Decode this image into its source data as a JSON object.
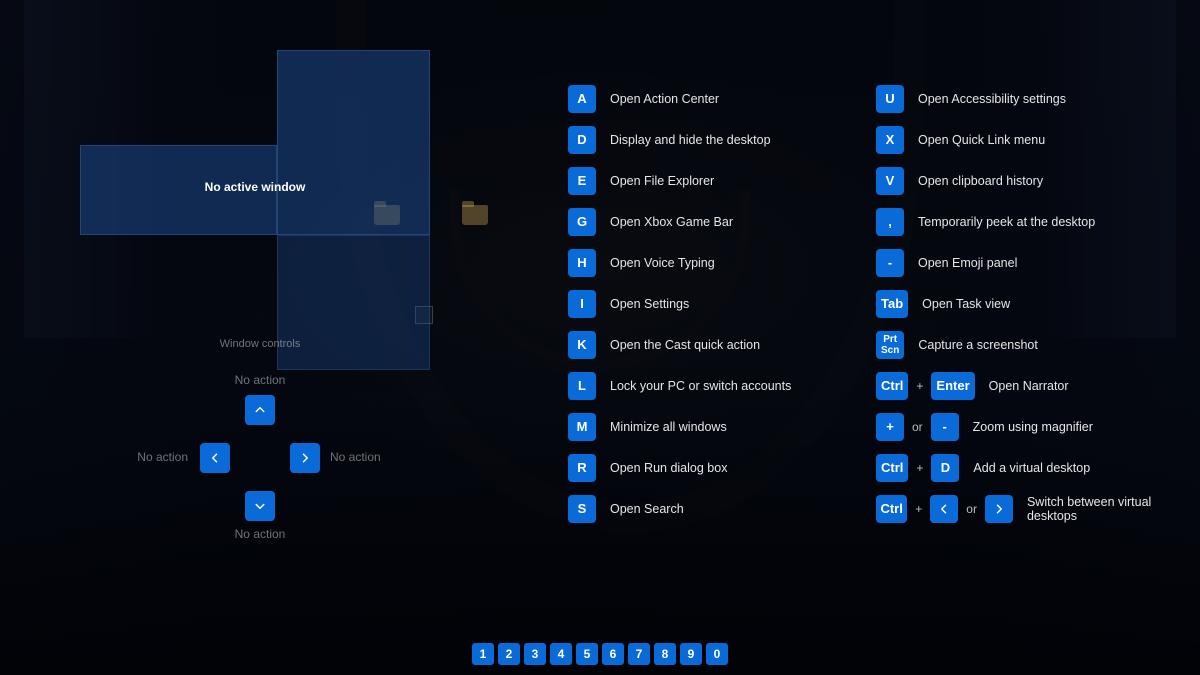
{
  "panel": {
    "no_active": "No active window",
    "section_label": "Window controls"
  },
  "dpad": {
    "up": "No action",
    "down": "No action",
    "left": "No action",
    "right": "No action"
  },
  "left_shortcuts": [
    {
      "key": "A",
      "desc": "Open Action Center"
    },
    {
      "key": "D",
      "desc": "Display and hide the desktop"
    },
    {
      "key": "E",
      "desc": "Open File Explorer"
    },
    {
      "key": "G",
      "desc": "Open Xbox Game Bar"
    },
    {
      "key": "H",
      "desc": "Open Voice Typing"
    },
    {
      "key": "I",
      "desc": "Open Settings"
    },
    {
      "key": "K",
      "desc": "Open the Cast quick action"
    },
    {
      "key": "L",
      "desc": "Lock your PC or switch accounts"
    },
    {
      "key": "M",
      "desc": "Minimize all windows"
    },
    {
      "key": "R",
      "desc": "Open Run dialog box"
    },
    {
      "key": "S",
      "desc": "Open Search"
    }
  ],
  "right_shortcuts": [
    {
      "keys": [
        "U"
      ],
      "desc": "Open Accessibility settings"
    },
    {
      "keys": [
        "X"
      ],
      "desc": "Open Quick Link menu"
    },
    {
      "keys": [
        "V"
      ],
      "desc": "Open clipboard history"
    },
    {
      "keys": [
        ","
      ],
      "desc": "Temporarily peek at the desktop"
    },
    {
      "keys": [
        "-"
      ],
      "desc": "Open Emoji panel"
    },
    {
      "keys": [
        "Tab"
      ],
      "desc": "Open Task view"
    },
    {
      "keys": [
        "Prt\nScn"
      ],
      "small": true,
      "desc": "Capture a screenshot"
    },
    {
      "keys": [
        "Ctrl",
        "+",
        "Enter"
      ],
      "desc": "Open Narrator"
    },
    {
      "keys": [
        "+",
        "or",
        "-"
      ],
      "desc": "Zoom using magnifier"
    },
    {
      "keys": [
        "Ctrl",
        "+",
        "D"
      ],
      "desc": "Add a virtual desktop"
    },
    {
      "keys": [
        "Ctrl",
        "+",
        "<",
        "or",
        ">"
      ],
      "arrows": true,
      "desc": "Switch between virtual desktops"
    }
  ],
  "numbers": [
    "1",
    "2",
    "3",
    "4",
    "5",
    "6",
    "7",
    "8",
    "9",
    "0"
  ]
}
